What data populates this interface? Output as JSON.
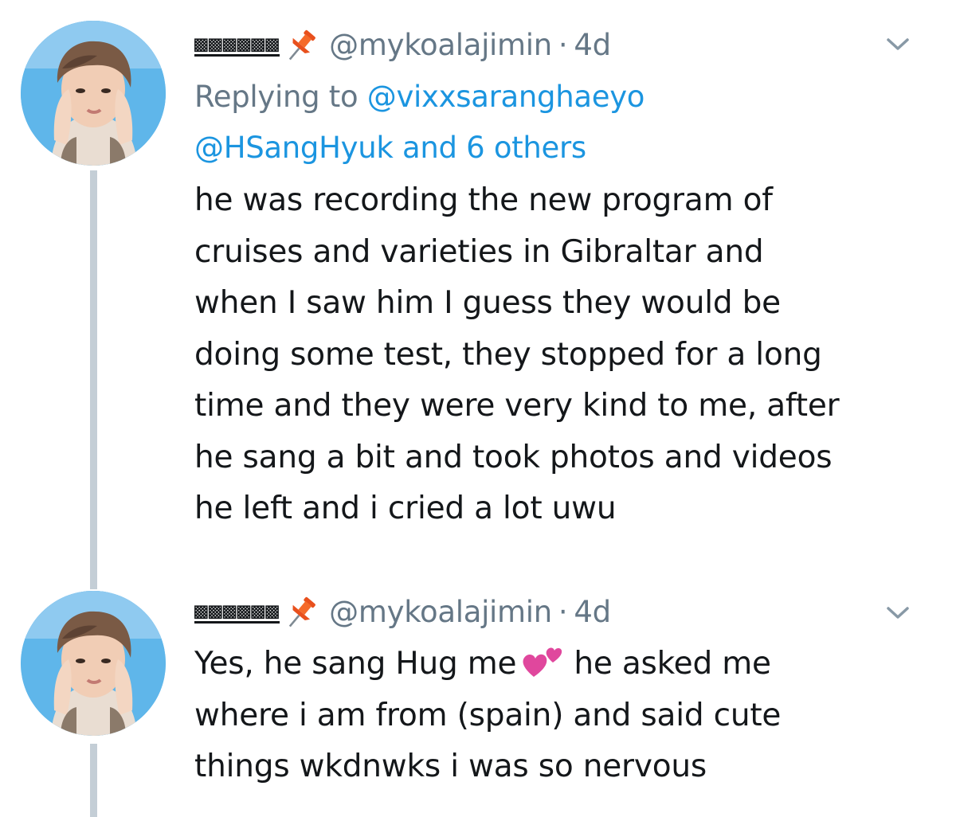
{
  "tweets": [
    {
      "display_name": "▩▩▩▩▩▩",
      "pin_emoji": "pushpin-icon",
      "handle": "@mykoalajimin",
      "separator": "·",
      "time": "4d",
      "reply_prefix": "Replying to",
      "reply_to_primary": "@vixxsaranghaeyo",
      "reply_to_secondary": "@HSangHyuk and 6 others",
      "lines": [
        "he was recording the new program of",
        "cruises and varieties in Gibraltar and",
        "when I saw him I guess they would be",
        "doing some test, they stopped for a long",
        "time and they were very kind to me, after",
        "he sang a bit and took photos and videos",
        "he left and i cried a lot uwu"
      ]
    },
    {
      "display_name": "▩▩▩▩▩▩",
      "pin_emoji": "pushpin-icon",
      "handle": "@mykoalajimin",
      "separator": "·",
      "time": "4d",
      "line1_before": "Yes, he sang Hug me",
      "line1_emoji": "two-hearts-icon",
      "line1_after": "he asked me",
      "lines": [
        "where i am from (spain) and said cute",
        "things wkdnwks i was so nervous"
      ]
    }
  ],
  "colors": {
    "text": "#14171a",
    "secondary": "#657786",
    "link": "#1b95e0",
    "thread_line": "#c4ced6",
    "avatar_bg": "#5fb6ea"
  }
}
